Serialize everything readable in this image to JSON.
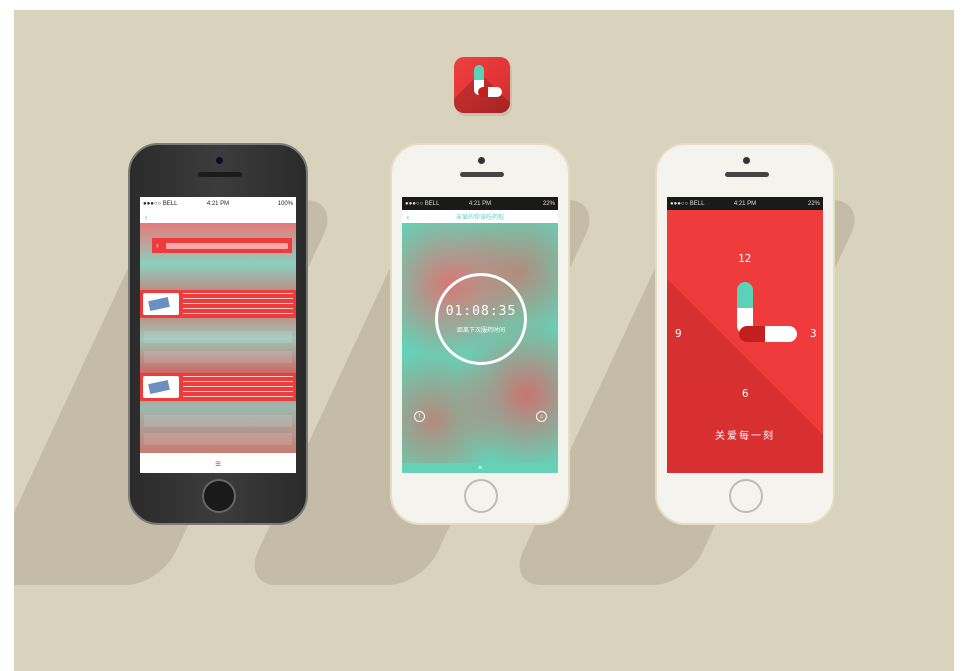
{
  "status_bar": {
    "carrier": "●●●○○ BELL",
    "time": "4:21 PM",
    "battery_1": "100%",
    "battery_2": "22%"
  },
  "screen1": {
    "tab_icon": "menu-icon"
  },
  "screen2": {
    "nav_title": "亲爱的你该吃药啦",
    "timer": "01:08:35",
    "timer_sub": "距离下次服药时间"
  },
  "screen3": {
    "n12": "12",
    "n3": "3",
    "n6": "6",
    "n9": "9",
    "slogan": "关爱每一刻"
  },
  "colors": {
    "brand_red": "#ee3b3b",
    "brand_teal": "#5bd2b8",
    "background": "#d9d2bd"
  }
}
